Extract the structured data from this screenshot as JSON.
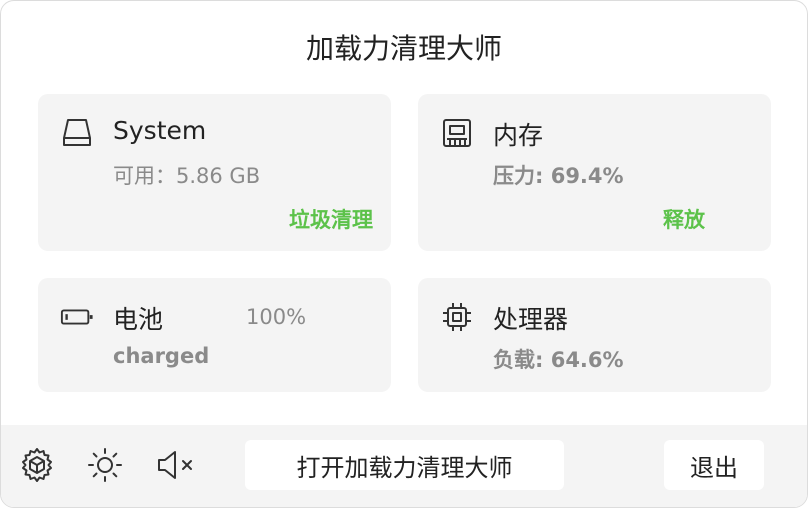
{
  "app": {
    "title": "加载力清理大师"
  },
  "cards": {
    "system": {
      "icon": "disk-icon",
      "name": "System",
      "sub": "可用：5.86 GB",
      "action": "垃圾清理"
    },
    "memory": {
      "icon": "memory-chip-icon",
      "name": "内存",
      "sub": "压力: 69.4%",
      "action": "释放"
    },
    "battery": {
      "icon": "battery-icon",
      "name": "电池",
      "percent": "100%",
      "sub": "charged"
    },
    "cpu": {
      "icon": "cpu-icon",
      "name": "处理器",
      "sub": "负载: 64.6%"
    }
  },
  "toolbar": {
    "gear_icon": "gear-icon",
    "brightness_icon": "brightness-icon",
    "mute_icon": "speaker-mute-icon",
    "open_label": "打开加载力清理大师",
    "quit_label": "退出"
  },
  "colors": {
    "accent_green": "#5cc24a",
    "card_bg": "#f4f4f4",
    "muted_text": "#8a8a8a"
  }
}
